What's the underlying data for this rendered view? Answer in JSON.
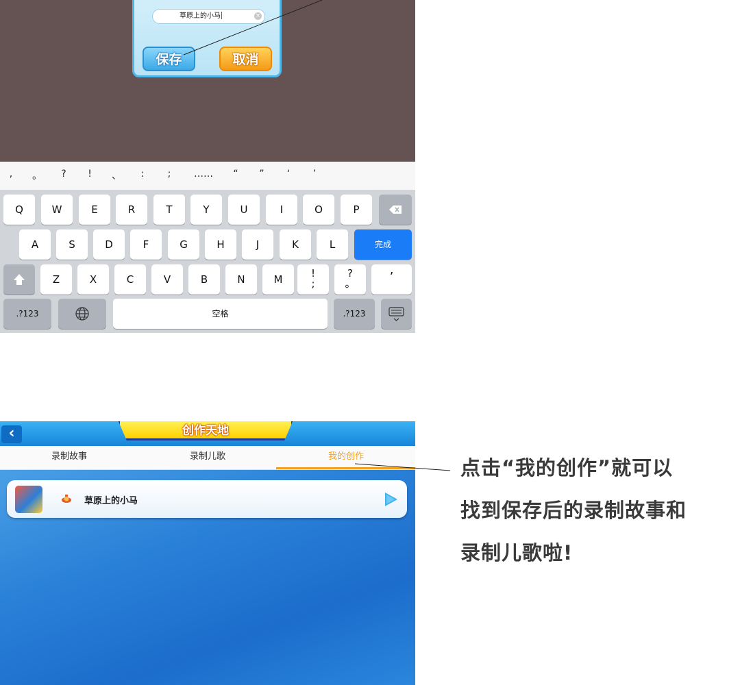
{
  "save_dialog": {
    "name_value": "草原上的小马",
    "save_label": "保存",
    "cancel_label": "取消"
  },
  "keyboard": {
    "punctuation": [
      ",",
      "。",
      "?",
      "!",
      "、",
      ":",
      ";",
      "……",
      "“",
      "”",
      "‘",
      "’"
    ],
    "row1": [
      "Q",
      "W",
      "E",
      "R",
      "T",
      "Y",
      "U",
      "I",
      "O",
      "P"
    ],
    "row2": [
      "A",
      "S",
      "D",
      "F",
      "G",
      "H",
      "J",
      "K",
      "L"
    ],
    "done_label": "完成",
    "row3": [
      "Z",
      "X",
      "C",
      "V",
      "B",
      "N",
      "M"
    ],
    "row3_extra": [
      "!\n;",
      "?\n。",
      "’"
    ],
    "numbers_label": ".?123",
    "space_label": "空格"
  },
  "app": {
    "title": "创作天地",
    "tabs": [
      "录制故事",
      "录制儿歌",
      "我的创作"
    ],
    "active_tab": 2,
    "list": [
      {
        "title": "草原上的小马"
      }
    ]
  },
  "caption": {
    "lines": [
      "点击“我的创作”就可以",
      "找到保存后的录制故事和",
      "录制儿歌啦!"
    ]
  },
  "colors": {
    "dialog_bg": "#655353",
    "accent_orange": "#f4a21c",
    "done_blue": "#1a7cf6",
    "app_blue": "#1f7fd6"
  }
}
